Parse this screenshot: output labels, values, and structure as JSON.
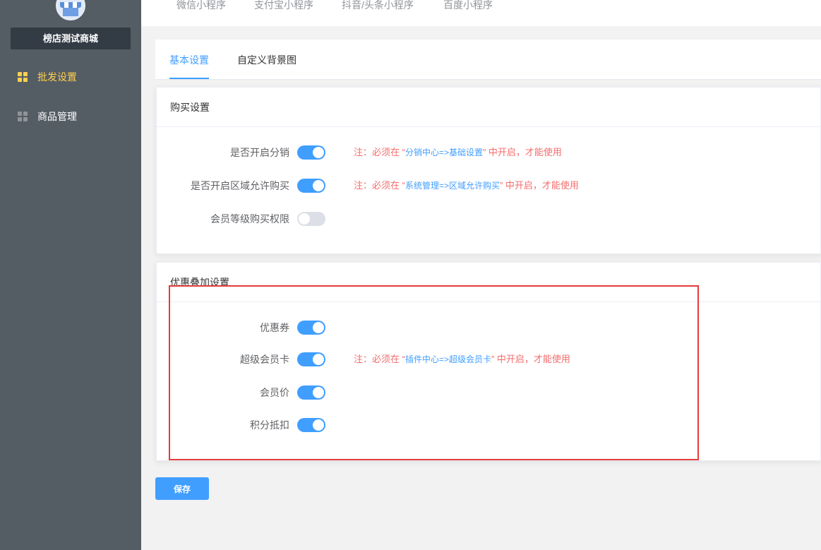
{
  "sidebar": {
    "shop_name": "榜店测试商城",
    "items": [
      {
        "label": "批发设置",
        "icon": "grid-icon",
        "active": true
      },
      {
        "label": "商品管理",
        "icon": "grid-icon",
        "active": false
      }
    ]
  },
  "top_tabs": [
    "微信小程序",
    "支付宝小程序",
    "抖音/头条小程序",
    "百度小程序"
  ],
  "sub_tabs": [
    {
      "label": "基本设置",
      "active": true
    },
    {
      "label": "自定义背景图",
      "active": false
    }
  ],
  "purchase": {
    "title": "购买设置",
    "rows": [
      {
        "label": "是否开启分销",
        "on": true,
        "note_prefix": "注：必须在 “",
        "note_link": "分销中心=>基础设置",
        "note_suffix": "” 中开启，才能使用"
      },
      {
        "label": "是否开启区域允许购买",
        "on": true,
        "note_prefix": "注：必须在 “",
        "note_link": "系统管理=>区域允许购买",
        "note_suffix": "” 中开启，才能使用"
      },
      {
        "label": "会员等级购买权限",
        "on": false
      }
    ]
  },
  "discount": {
    "title": "优惠叠加设置",
    "rows": [
      {
        "label": "优惠券",
        "on": true
      },
      {
        "label": "超级会员卡",
        "on": true,
        "note_prefix": "注：必须在 “",
        "note_link": "插件中心=>超级会员卡",
        "note_suffix": "” 中开启，才能使用"
      },
      {
        "label": "会员价",
        "on": true
      },
      {
        "label": "积分抵扣",
        "on": true
      }
    ]
  },
  "save_label": "保存",
  "colors": {
    "primary": "#409eff",
    "warning_text": "#f56c6c",
    "sidebar_bg": "#545c64",
    "active_menu": "#ffd04b",
    "highlight_border": "#e33b3b"
  }
}
